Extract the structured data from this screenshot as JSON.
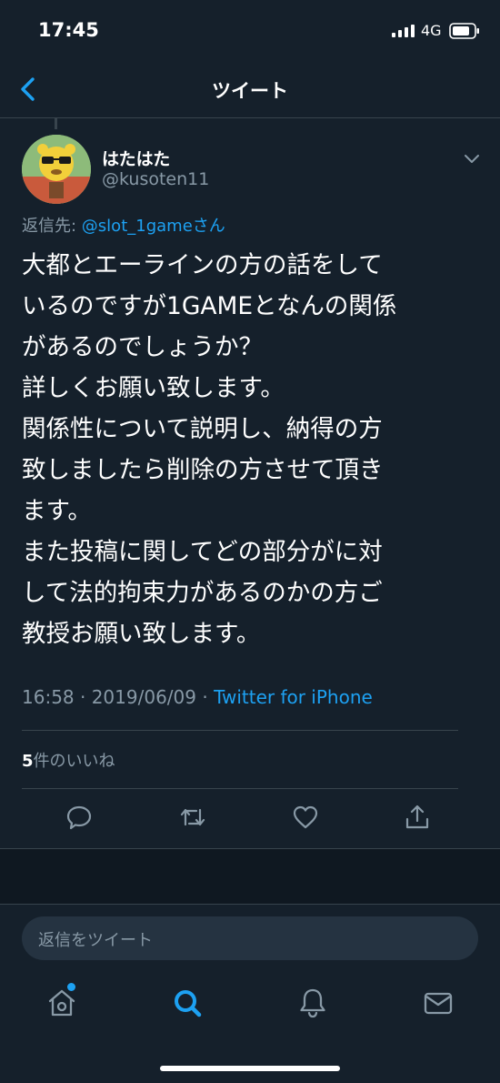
{
  "status_bar": {
    "time": "17:45",
    "network": "4G"
  },
  "nav": {
    "title": "ツイート"
  },
  "tweet": {
    "display_name": "はたはた",
    "handle": "@kusoten11",
    "reply_prefix": "返信先: ",
    "reply_to": "@slot_1gameさん",
    "lines": [
      "大都とエーラインの方の話をして",
      "いるのですが1GAMEとなんの関係",
      "があるのでしょうか？",
      "詳しくお願い致します。",
      "関係性について説明し、納得の方",
      "致しましたら削除の方させて頂き",
      "ます。",
      "また投稿に関してどの部分がに対",
      "して法的拘束力があるのかの方ご",
      "教授お願い致します。"
    ],
    "timestamp": "16:58 · 2019/06/09 · ",
    "source": "Twitter for iPhone",
    "likes_count": "5",
    "likes_label": "件のいいね"
  },
  "reply": {
    "placeholder": "返信をツイート"
  },
  "icons": {
    "back": "chevron-left-icon",
    "reply": "comment-icon",
    "retweet": "retweet-icon",
    "like": "heart-icon",
    "share": "share-icon",
    "home": "home-icon",
    "search": "search-icon",
    "notifications": "bell-icon",
    "messages": "mail-icon"
  },
  "colors": {
    "background": "#15202b",
    "accent": "#1da1f2",
    "secondary_text": "#8899a6",
    "divider": "#38444d"
  }
}
